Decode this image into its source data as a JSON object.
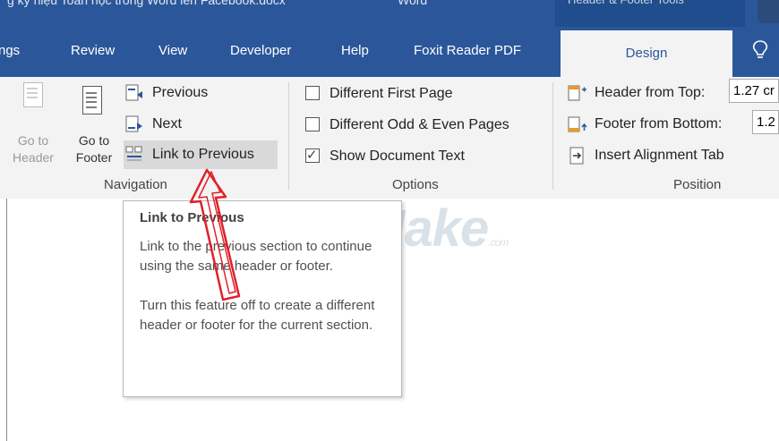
{
  "window": {
    "doc_title": "g ký hiệu Toán học trong Word lên Facebook.docx",
    "app_name": "Word",
    "context_tab": "Header & Footer Tools"
  },
  "tabs": [
    {
      "label": "ngs"
    },
    {
      "label": "Review"
    },
    {
      "label": "View"
    },
    {
      "label": "Developer"
    },
    {
      "label": "Help"
    },
    {
      "label": "Foxit Reader PDF"
    },
    {
      "label": "Design"
    }
  ],
  "navigation": {
    "goto_header": {
      "line1": "Go to",
      "line2": "Header"
    },
    "goto_footer": {
      "line1": "Go to",
      "line2": "Footer"
    },
    "previous": "Previous",
    "next": "Next",
    "link_to_previous": "Link to Previous",
    "group_label": "Navigation"
  },
  "options": {
    "different_first_page": {
      "label": "Different First Page",
      "checked": false
    },
    "different_odd_even": {
      "label": "Different Odd & Even Pages",
      "checked": false
    },
    "show_document_text": {
      "label": "Show Document Text",
      "checked": true
    },
    "group_label": "Options"
  },
  "position": {
    "header_from_top": {
      "label": "Header from Top:",
      "value": "1.27 cr"
    },
    "footer_from_bottom": {
      "label": "Footer from Bottom:",
      "value": "1.2"
    },
    "insert_alignment_tab": "Insert Alignment Tab",
    "group_label": "Position"
  },
  "tooltip": {
    "title": "Link to Previous",
    "para1": "Link to the previous section to continue using the same header or footer.",
    "para2": "Turn this feature off to create a different header or footer for the current section."
  },
  "watermark": {
    "brand": "TipsMake",
    "suffix": ".com"
  },
  "colors": {
    "word_blue": "#2b579a",
    "ribbon_bg": "#f3f3f3",
    "hover_gray": "#d9d9d9",
    "arrow_red": "#e0202a"
  }
}
